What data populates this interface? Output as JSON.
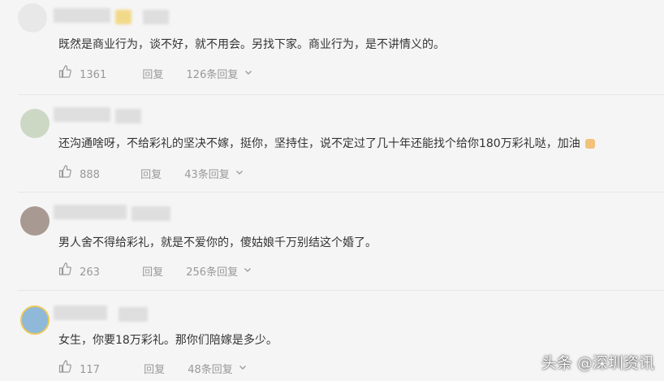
{
  "comments": [
    {
      "text": "既然是商业行为，谈不好，就不用会。另找下家。商业行为，是不讲情义的。",
      "likes": "1361",
      "reply_label": "回复",
      "replies_label": "126条回复"
    },
    {
      "text": "还沟通啥呀，不给彩礼的坚决不嫁，挺你，坚持住，说不定过了几十年还能找个给你180万彩礼哒，加油",
      "likes": "888",
      "reply_label": "回复",
      "replies_label": "43条回复"
    },
    {
      "text": "男人舍不得给彩礼，就是不爱你的，傻姑娘千万别结这个婚了。",
      "likes": "263",
      "reply_label": "回复",
      "replies_label": "256条回复"
    },
    {
      "text": "女生，你要18万彩礼。那你们陪嫁是多少。",
      "likes": "117",
      "reply_label": "回复",
      "replies_label": "48条回复"
    }
  ],
  "watermark": "头条 @深圳资讯",
  "colors": {
    "background": "#f5f5f5",
    "text": "#333333",
    "muted": "#999999"
  }
}
